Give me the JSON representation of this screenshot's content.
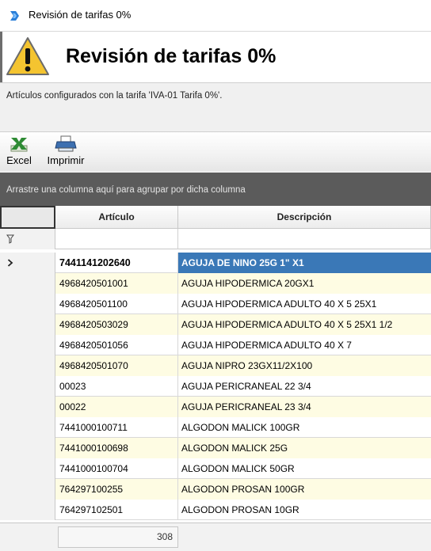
{
  "window": {
    "title": "Revisión de tarifas 0%"
  },
  "header": {
    "heading": "Revisión de tarifas 0%"
  },
  "subtitle": "Artículos configurados con la tarifa 'IVA-01 Tarifa 0%'.",
  "toolbar": {
    "excel_label": "Excel",
    "print_label": "Imprimir"
  },
  "group_hint": "Arrastre una columna aquí para agrupar por dicha columna",
  "columns": {
    "articulo": "Artículo",
    "descripcion": "Descripción"
  },
  "rows": [
    {
      "articulo": "7441141202640",
      "descripcion": "AGUJA DE NINO 25G 1\" X1"
    },
    {
      "articulo": "4968420501001",
      "descripcion": "AGUJA HIPODERMICA 20GX1"
    },
    {
      "articulo": "4968420501100",
      "descripcion": "AGUJA HIPODERMICA ADULTO 40 X 5 25X1"
    },
    {
      "articulo": "4968420503029",
      "descripcion": "AGUJA HIPODERMICA ADULTO 40 X 5 25X1 1/2"
    },
    {
      "articulo": "4968420501056",
      "descripcion": "AGUJA HIPODERMICA ADULTO 40 X 7"
    },
    {
      "articulo": "4968420501070",
      "descripcion": "AGUJA NIPRO 23GX11/2X100"
    },
    {
      "articulo": "00023",
      "descripcion": "AGUJA PERICRANEAL 22 3/4"
    },
    {
      "articulo": "00022",
      "descripcion": "AGUJA PERICRANEAL 23 3/4"
    },
    {
      "articulo": "7441000100711",
      "descripcion": "ALGODON MALICK 100GR"
    },
    {
      "articulo": "7441000100698",
      "descripcion": "ALGODON MALICK 25G"
    },
    {
      "articulo": "7441000100704",
      "descripcion": "ALGODON MALICK 50GR"
    },
    {
      "articulo": "764297100255",
      "descripcion": "ALGODON PROSAN 100GR"
    },
    {
      "articulo": "764297102501",
      "descripcion": "ALGODON PROSAN 10GR"
    }
  ],
  "footer": {
    "count": "308"
  },
  "colors": {
    "selection": "#3a78b7",
    "alt_row": "#fefce3",
    "group_bar": "#5b5b5b"
  }
}
